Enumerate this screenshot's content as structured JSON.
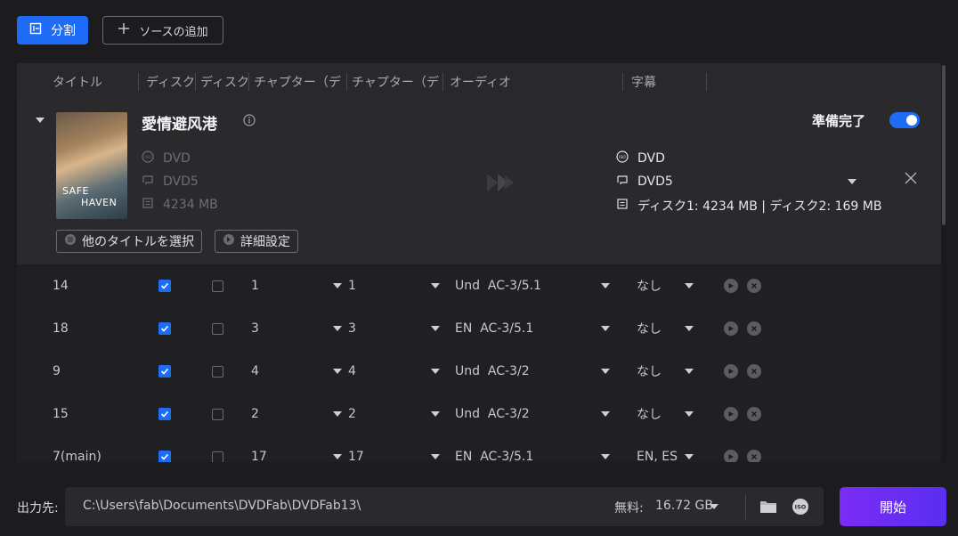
{
  "toolbar": {
    "split_label": "分割",
    "add_source_label": "ソースの追加"
  },
  "table_header": {
    "columns": [
      "タイトル",
      "ディスク",
      "ディスク",
      "チャプター（デ",
      "チャプター（デ",
      "オーディオ",
      "字幕"
    ]
  },
  "title_block": {
    "movie_title": "愛情避风港",
    "poster_text_1": "SAFE",
    "poster_text_2": "HAVEN",
    "ready_label": "準備完了",
    "ready_on": true,
    "source": {
      "type": "DVD",
      "disc": "DVD5",
      "size": "4234 MB"
    },
    "target": {
      "type": "DVD",
      "disc": "DVD5",
      "size": "ディスク1: 4234 MB | ディスク2: 169 MB"
    },
    "select_other_label": "他のタイトルを選択",
    "advanced_label": "詳細設定"
  },
  "rows": [
    {
      "title": "14",
      "disc1": true,
      "disc2": false,
      "ch_start": "1",
      "ch_end": "1",
      "audio": "Und  AC-3/5.1",
      "subtitle": "なし"
    },
    {
      "title": "18",
      "disc1": true,
      "disc2": false,
      "ch_start": "3",
      "ch_end": "3",
      "audio": "EN  AC-3/5.1",
      "subtitle": "なし"
    },
    {
      "title": "9",
      "disc1": true,
      "disc2": false,
      "ch_start": "4",
      "ch_end": "4",
      "audio": "Und  AC-3/2",
      "subtitle": "なし"
    },
    {
      "title": "15",
      "disc1": true,
      "disc2": false,
      "ch_start": "2",
      "ch_end": "2",
      "audio": "Und  AC-3/2",
      "subtitle": "なし"
    },
    {
      "title": "7(main)",
      "disc1": true,
      "disc2": false,
      "ch_start": "17",
      "ch_end": "17",
      "audio": "EN  AC-3/5.1",
      "subtitle": "EN, ES"
    }
  ],
  "footer": {
    "output_label": "出力先:",
    "path": "C:\\Users\\fab\\Documents\\DVDFab\\DVDFab13\\",
    "free_label": "無料:",
    "free_value": "16.72 GB",
    "start_label": "開始"
  },
  "colors": {
    "accent": "#1e6cf5",
    "start": "#7b2cf5",
    "background": "#1c1c1f"
  }
}
